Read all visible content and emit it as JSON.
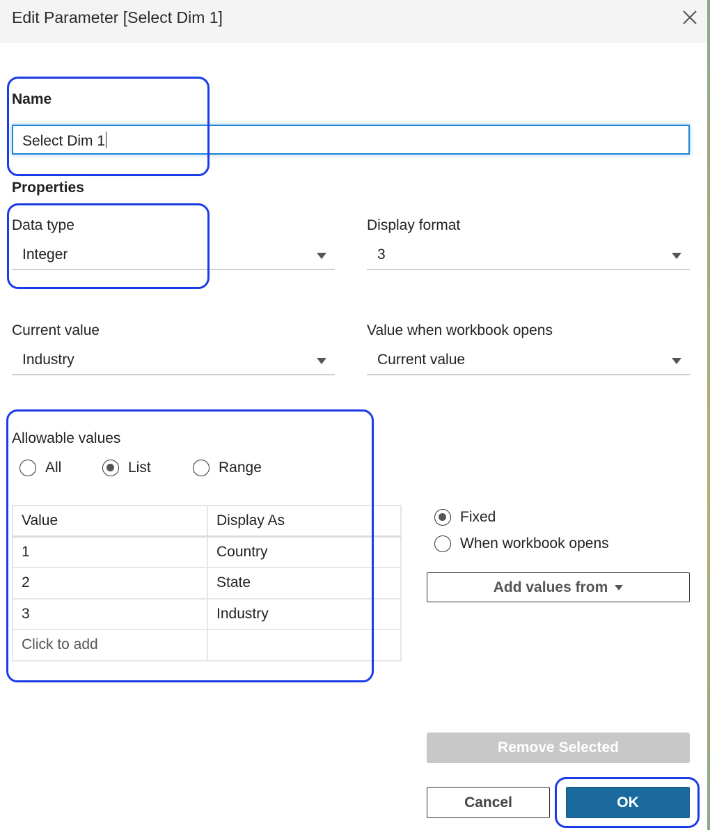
{
  "dialog": {
    "title": "Edit Parameter [Select Dim 1]",
    "close_icon": "close-icon"
  },
  "name_section": {
    "label": "Name",
    "value": "Select Dim 1"
  },
  "properties": {
    "heading": "Properties",
    "data_type": {
      "label": "Data type",
      "value": "Integer"
    },
    "display_format": {
      "label": "Display format",
      "value": "3"
    },
    "current_value": {
      "label": "Current value",
      "value": "Industry"
    },
    "value_when_opens": {
      "label": "Value when workbook opens",
      "value": "Current value"
    }
  },
  "allowable_values": {
    "label": "Allowable values",
    "options": [
      {
        "label": "All",
        "checked": false
      },
      {
        "label": "List",
        "checked": true
      },
      {
        "label": "Range",
        "checked": false
      }
    ],
    "table": {
      "headers": [
        "Value",
        "Display As"
      ],
      "rows": [
        {
          "value": "1",
          "display": "Country"
        },
        {
          "value": "2",
          "display": "State"
        },
        {
          "value": "3",
          "display": "Industry"
        }
      ],
      "add_placeholder": "Click to add"
    }
  },
  "list_refresh": {
    "options": [
      {
        "label": "Fixed",
        "checked": true
      },
      {
        "label": "When workbook opens",
        "checked": false
      }
    ],
    "add_values_from_label": "Add values from"
  },
  "buttons": {
    "remove_selected": "Remove Selected",
    "cancel": "Cancel",
    "ok": "OK"
  },
  "colors": {
    "highlight": "#1a3ce8",
    "ok_button": "#1b6a9f",
    "focus_border": "#1f86d6",
    "disabled_button": "#c8c8c8"
  }
}
